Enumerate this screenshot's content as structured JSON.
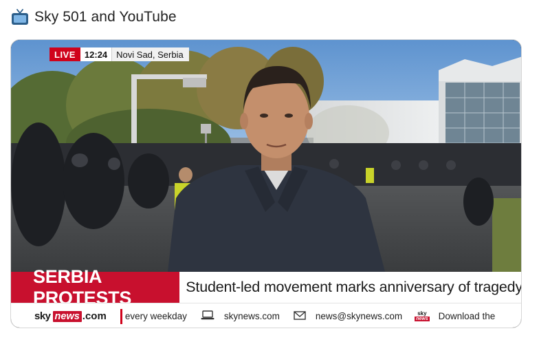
{
  "post": {
    "icon": "tv-icon",
    "title": "Sky 501 and YouTube"
  },
  "video": {
    "live_label": "LIVE",
    "time": "12:24",
    "location": "Novi Sad, Serbia",
    "headline_tag": "SERBIA PROTESTS",
    "headline_text": "Student-led movement marks anniversary of tragedy",
    "ticker": {
      "logo_sky": "sky",
      "logo_news": "news",
      "logo_dotcom": ".com",
      "items": [
        {
          "icon": "",
          "text": "every weekday"
        },
        {
          "icon": "laptop-icon",
          "text": "skynews.com"
        },
        {
          "icon": "envelope-icon",
          "text": "news@skynews.com"
        },
        {
          "icon": "sky-news-logo-icon",
          "text": "Download the"
        }
      ],
      "mini_logo_sky": "sky",
      "mini_logo_news": "news"
    },
    "colors": {
      "brand_red": "#c8102e",
      "live_red": "#d0021b",
      "sky_blue": "#6fa3d9"
    }
  }
}
